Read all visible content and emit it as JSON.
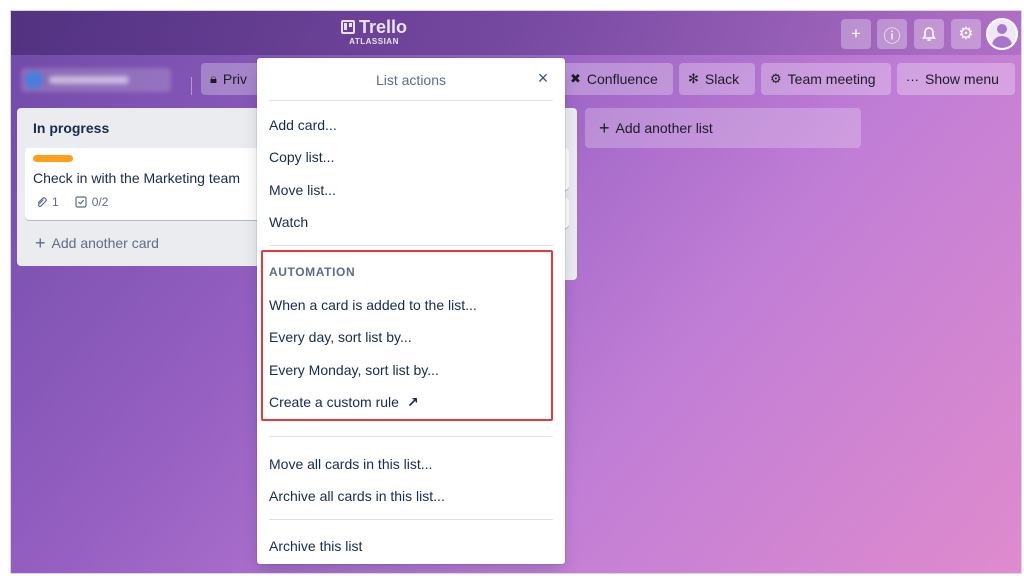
{
  "header": {
    "logo_text": "Trello",
    "logo_sub": "ATLASSIAN",
    "buttons": [
      {
        "name": "add",
        "glyph": "+"
      },
      {
        "name": "info",
        "glyph": "ⓘ"
      },
      {
        "name": "notifications",
        "glyph": "🔔"
      },
      {
        "name": "settings",
        "glyph": "⚙"
      }
    ]
  },
  "boardbar": {
    "visibility_label": "Priv",
    "items": [
      {
        "label": "Confluence",
        "icon": "confluence-icon",
        "glyph": "✖"
      },
      {
        "label": "Slack",
        "icon": "slack-icon",
        "glyph": "✻"
      },
      {
        "label": "Team meeting",
        "icon": "gears-icon",
        "glyph": "⚙"
      },
      {
        "label": "Show menu",
        "icon": "ellipsis-icon",
        "glyph": "···"
      }
    ]
  },
  "list": {
    "title": "In progress",
    "card": {
      "label_color": "#ff9f1a",
      "title": "Check in with the Marketing team",
      "attachments": "1",
      "checklist": "0/2"
    },
    "add_card": "Add another card"
  },
  "add_list": "Add another list",
  "popover": {
    "title": "List actions",
    "close_glyph": "×",
    "items": [
      "Add card...",
      "Copy list...",
      "Move list...",
      "Watch"
    ],
    "automation": {
      "heading": "AUTOMATION",
      "items": [
        "When a card is added to the list...",
        "Every day, sort list by...",
        "Every Monday, sort list by...",
        "Create a custom rule"
      ],
      "external_glyph": "↗",
      "highlight_color": "#e5393f"
    },
    "bulk_items": [
      "Move all cards in this list...",
      "Archive all cards in this list..."
    ],
    "archive_item": "Archive this list"
  }
}
